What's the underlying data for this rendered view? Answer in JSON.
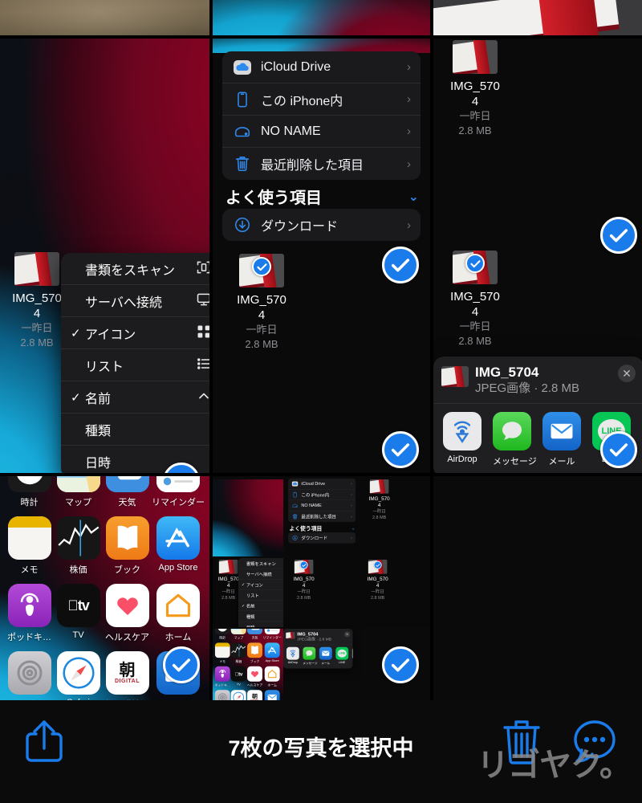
{
  "screen": {
    "app": "photos-multiselect",
    "background": "#000000",
    "accent_blue": "#1a7ceb"
  },
  "toolbar": {
    "status_text": "7枚の写真を選択中",
    "share_icon": "share-icon",
    "trash_icon": "trash-icon",
    "more_icon": "more-chat-icon",
    "watermark": "リゴヤク。"
  },
  "files_panel": {
    "locations": [
      {
        "label": "iCloud Drive",
        "icon": "icloud-icon",
        "chevron": "›"
      },
      {
        "label": "この iPhone内",
        "icon": "iphone-icon",
        "chevron": "›"
      },
      {
        "label": "NO NAME",
        "icon": "drive-icon",
        "chevron": "›"
      },
      {
        "label": "最近削除した項目",
        "icon": "trash-icon",
        "chevron": "›"
      }
    ],
    "favorites_header": "よく使う項目",
    "favorites_caret": "chevron-down-icon",
    "favorites": [
      {
        "label": "ダウンロード",
        "icon": "download-icon",
        "chevron": "›"
      }
    ]
  },
  "context_menu": {
    "items": [
      {
        "label": "書類をスキャン",
        "checked": "",
        "icon": "scan-icon"
      },
      {
        "label": "サーバへ接続",
        "checked": "",
        "icon": "server-icon"
      },
      {
        "label": "アイコン",
        "checked": "✓",
        "icon": "grid-icon"
      },
      {
        "label": "リスト",
        "checked": "",
        "icon": "list-icon"
      },
      {
        "label": "名前",
        "checked": "✓",
        "icon": "chevron-up-icon"
      },
      {
        "label": "種類",
        "checked": "",
        "icon": ""
      },
      {
        "label": "日時",
        "checked": "",
        "icon": ""
      }
    ]
  },
  "file_item": {
    "name": "IMG_5704",
    "name_line1": "IMG_570",
    "name_line2": "4",
    "date": "一昨日",
    "size": "2.8 MB"
  },
  "share_sheet": {
    "title": "IMG_5704",
    "subtitle": "JPEG画像 · 2.8 MB",
    "close_icon": "✕",
    "apps": [
      {
        "name": "AirDrop",
        "icon": "airdrop-icon"
      },
      {
        "name": "メッセージ",
        "icon": "messages-icon"
      },
      {
        "name": "メール",
        "icon": "mail-icon"
      },
      {
        "name": "LINE",
        "icon": "line-icon"
      },
      {
        "name": "",
        "icon": "notes-icon"
      }
    ]
  },
  "home_screen": {
    "apps": [
      {
        "name": "時計",
        "icon": "clock-icon"
      },
      {
        "name": "マップ",
        "icon": "maps-icon"
      },
      {
        "name": "天気",
        "icon": "weather-icon"
      },
      {
        "name": "リマインダー",
        "icon": "reminders-icon"
      },
      {
        "name": "メモ",
        "icon": "notes-icon"
      },
      {
        "name": "株価",
        "icon": "stocks-icon"
      },
      {
        "name": "ブック",
        "icon": "books-icon"
      },
      {
        "name": "App Store",
        "icon": "appstore-icon"
      },
      {
        "name": "ポッドキ…",
        "icon": "podcasts-icon"
      },
      {
        "name": "TV",
        "icon": "appletv-icon"
      },
      {
        "name": "ヘルスケア",
        "icon": "health-icon"
      },
      {
        "name": "ホーム",
        "icon": "home-icon"
      },
      {
        "name": "設定",
        "icon": "settings-icon"
      },
      {
        "name": "Safari",
        "icon": "safari-icon"
      },
      {
        "name": "新聞購読…",
        "icon": "asahi-icon"
      },
      {
        "name": "メール",
        "icon": "mail-icon"
      }
    ]
  },
  "selection": {
    "count": 7,
    "checked_badge": "checkmark-circle-icon"
  }
}
